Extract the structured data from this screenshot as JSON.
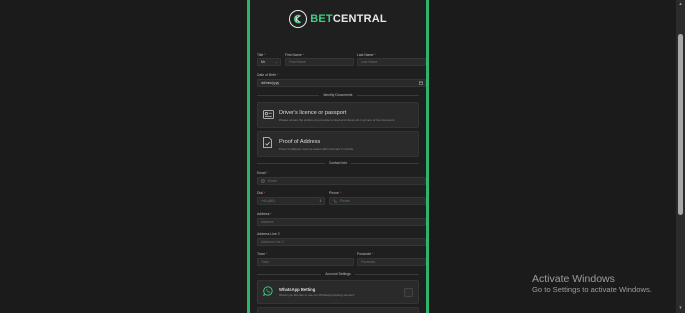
{
  "brand": {
    "logo_letter": "C",
    "name_prefix": "BET",
    "name_suffix": "CENTRAL"
  },
  "form": {
    "title": {
      "label": "Title",
      "value": "Mr"
    },
    "first_name": {
      "label": "First Name",
      "placeholder": "First Name"
    },
    "last_name": {
      "label": "Last Name",
      "placeholder": "Last Name"
    },
    "dob": {
      "label": "Date of Birth",
      "placeholder": "dd/mm/yyyy"
    },
    "identity_section": "Identity Documents",
    "license_card": {
      "title": "Driver's licence or passport",
      "desc": "Please ensure the picture you provide is clear and shows all 4 corners of the document."
    },
    "address_card": {
      "title": "Proof of Address",
      "desc": "Proof of address must be dated within the last 3 months."
    },
    "contact_section": "Contact Info",
    "email": {
      "label": "Email",
      "placeholder": "Email"
    },
    "dial": {
      "label": "Dial",
      "value": "+44 (UK)"
    },
    "phone": {
      "label": "Phone",
      "placeholder": "Phone"
    },
    "address": {
      "label": "Address",
      "placeholder": "Address"
    },
    "address2": {
      "label": "Address Line 2",
      "placeholder": "Address Line 2"
    },
    "town": {
      "label": "Town",
      "placeholder": "Town"
    },
    "postcode": {
      "label": "Postcode",
      "placeholder": "Postcode"
    },
    "account_section": "Account Settings",
    "whatsapp": {
      "title": "WhatsApp Betting",
      "desc": "Would you like like to use our WhatsApp betting service?"
    },
    "required_mark": "*"
  },
  "watermark": {
    "line1": "Activate Windows",
    "line2": "Go to Settings to activate Windows."
  },
  "colors": {
    "accent": "#2fb56a",
    "background": "#1b1b1b",
    "panel": "#1f1f1f",
    "field": "#2a2a2a"
  }
}
